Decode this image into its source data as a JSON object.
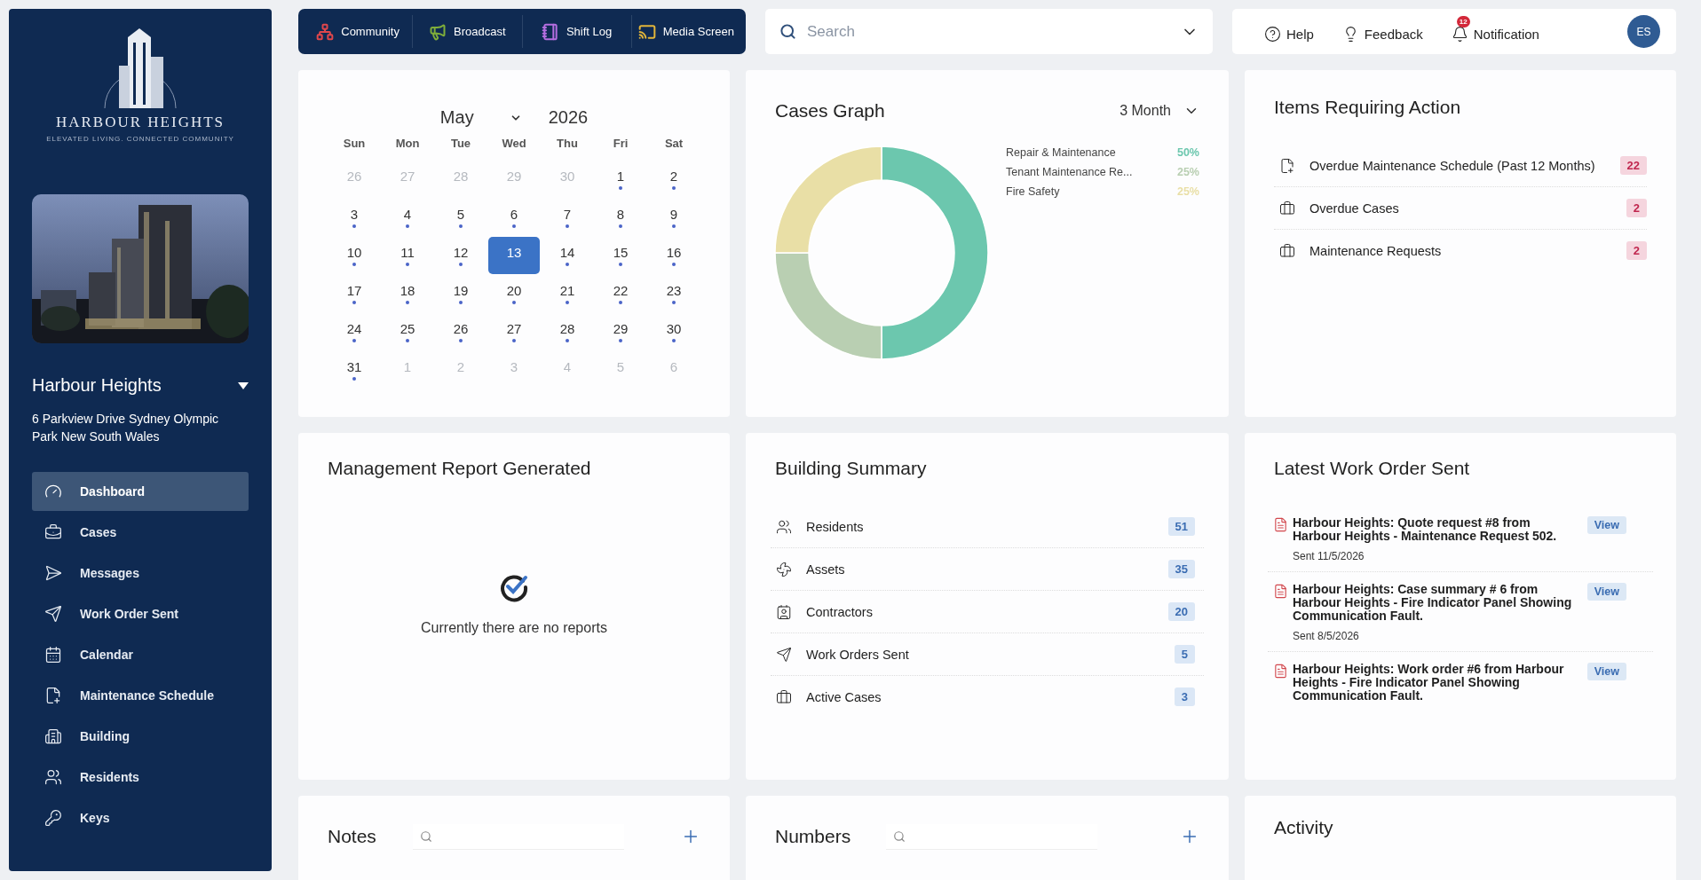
{
  "sidebar": {
    "logo": {
      "name": "HARBOUR HEIGHTS",
      "tagline": "ELEVATED LIVING. CONNECTED COMMUNITY"
    },
    "building": {
      "name": "Harbour Heights",
      "address": "6 Parkview Drive Sydney Olympic Park New South Wales"
    },
    "items": [
      {
        "label": "Dashboard",
        "selected": true
      },
      {
        "label": "Cases",
        "selected": false
      },
      {
        "label": "Messages",
        "selected": false
      },
      {
        "label": "Work Order Sent",
        "selected": false
      },
      {
        "label": "Calendar",
        "selected": false
      },
      {
        "label": "Maintenance Schedule",
        "selected": false
      },
      {
        "label": "Building",
        "selected": false
      },
      {
        "label": "Residents",
        "selected": false
      },
      {
        "label": "Keys",
        "selected": false
      }
    ]
  },
  "top_nav": [
    {
      "label": "Community",
      "color": "#e0474c"
    },
    {
      "label": "Broadcast",
      "color": "#7fae3a"
    },
    {
      "label": "Shift Log",
      "color": "#b56ee0"
    },
    {
      "label": "Media Screen",
      "color": "#e2b53a"
    }
  ],
  "search": {
    "placeholder": "Search"
  },
  "header_links": [
    {
      "label": "Help"
    },
    {
      "label": "Feedback"
    },
    {
      "label": "Notification",
      "badge": "12"
    }
  ],
  "avatar": "ES",
  "calendar": {
    "month": "May",
    "year": "2026",
    "weekdays": [
      "Sun",
      "Mon",
      "Tue",
      "Wed",
      "Thu",
      "Fri",
      "Sat"
    ],
    "days": [
      {
        "day": "26",
        "muted": true,
        "dot": false,
        "selected": false
      },
      {
        "day": "27",
        "muted": true,
        "dot": false,
        "selected": false
      },
      {
        "day": "28",
        "muted": true,
        "dot": false,
        "selected": false
      },
      {
        "day": "29",
        "muted": true,
        "dot": false,
        "selected": false
      },
      {
        "day": "30",
        "muted": true,
        "dot": false,
        "selected": false
      },
      {
        "day": "1",
        "muted": false,
        "dot": true,
        "selected": false
      },
      {
        "day": "2",
        "muted": false,
        "dot": true,
        "selected": false
      },
      {
        "day": "3",
        "muted": false,
        "dot": true,
        "selected": false
      },
      {
        "day": "4",
        "muted": false,
        "dot": true,
        "selected": false
      },
      {
        "day": "5",
        "muted": false,
        "dot": true,
        "selected": false
      },
      {
        "day": "6",
        "muted": false,
        "dot": true,
        "selected": false
      },
      {
        "day": "7",
        "muted": false,
        "dot": true,
        "selected": false
      },
      {
        "day": "8",
        "muted": false,
        "dot": true,
        "selected": false
      },
      {
        "day": "9",
        "muted": false,
        "dot": true,
        "selected": false
      },
      {
        "day": "10",
        "muted": false,
        "dot": true,
        "selected": false
      },
      {
        "day": "11",
        "muted": false,
        "dot": true,
        "selected": false
      },
      {
        "day": "12",
        "muted": false,
        "dot": true,
        "selected": false
      },
      {
        "day": "13",
        "muted": false,
        "dot": false,
        "selected": true
      },
      {
        "day": "14",
        "muted": false,
        "dot": true,
        "selected": false
      },
      {
        "day": "15",
        "muted": false,
        "dot": true,
        "selected": false
      },
      {
        "day": "16",
        "muted": false,
        "dot": true,
        "selected": false
      },
      {
        "day": "17",
        "muted": false,
        "dot": true,
        "selected": false
      },
      {
        "day": "18",
        "muted": false,
        "dot": true,
        "selected": false
      },
      {
        "day": "19",
        "muted": false,
        "dot": true,
        "selected": false
      },
      {
        "day": "20",
        "muted": false,
        "dot": true,
        "selected": false
      },
      {
        "day": "21",
        "muted": false,
        "dot": true,
        "selected": false
      },
      {
        "day": "22",
        "muted": false,
        "dot": true,
        "selected": false
      },
      {
        "day": "23",
        "muted": false,
        "dot": true,
        "selected": false
      },
      {
        "day": "24",
        "muted": false,
        "dot": true,
        "selected": false
      },
      {
        "day": "25",
        "muted": false,
        "dot": true,
        "selected": false
      },
      {
        "day": "26",
        "muted": false,
        "dot": true,
        "selected": false
      },
      {
        "day": "27",
        "muted": false,
        "dot": true,
        "selected": false
      },
      {
        "day": "28",
        "muted": false,
        "dot": true,
        "selected": false
      },
      {
        "day": "29",
        "muted": false,
        "dot": true,
        "selected": false
      },
      {
        "day": "30",
        "muted": false,
        "dot": true,
        "selected": false
      },
      {
        "day": "31",
        "muted": false,
        "dot": true,
        "selected": false
      },
      {
        "day": "1",
        "muted": true,
        "dot": false,
        "selected": false
      },
      {
        "day": "2",
        "muted": true,
        "dot": false,
        "selected": false
      },
      {
        "day": "3",
        "muted": true,
        "dot": false,
        "selected": false
      },
      {
        "day": "4",
        "muted": true,
        "dot": false,
        "selected": false
      },
      {
        "day": "5",
        "muted": true,
        "dot": false,
        "selected": false
      },
      {
        "day": "6",
        "muted": true,
        "dot": false,
        "selected": false
      }
    ]
  },
  "cases_graph": {
    "title": "Cases Graph",
    "range": "3 Month",
    "legend": [
      {
        "value": "50%",
        "color": "#6cc7ae"
      },
      {
        "value": "25%",
        "color": "#b9cfb2"
      },
      {
        "value": "25%",
        "color": "#e9dfa6"
      }
    ],
    "chart_data": {
      "type": "donut",
      "categories": [
        "Repair & Maintenance",
        "Tenant Maintenance Re...",
        "Fire Safety"
      ],
      "values": [
        50,
        25,
        25
      ]
    }
  },
  "items_requiring_action": {
    "title": "Items Requiring Action",
    "items": [
      {
        "label": "Overdue Maintenance Schedule (Past 12 Months)",
        "count": "22"
      },
      {
        "label": "Overdue Cases",
        "count": "2"
      },
      {
        "label": "Maintenance Requests",
        "count": "2"
      }
    ]
  },
  "management_report": {
    "title": "Management Report Generated",
    "empty_text": "Currently there are no reports"
  },
  "building_summary": {
    "title": "Building Summary",
    "items": [
      {
        "label": "Residents",
        "count": "51"
      },
      {
        "label": "Assets",
        "count": "35"
      },
      {
        "label": "Contractors",
        "count": "20"
      },
      {
        "label": "Work Orders Sent",
        "count": "5"
      },
      {
        "label": "Active Cases",
        "count": "3"
      }
    ]
  },
  "latest_work_order": {
    "title": "Latest Work Order Sent",
    "items": [
      {
        "title": "Harbour Heights: Quote request #8 from Harbour Heights - Maintenance Request 502.",
        "date": "Sent 11/5/2026",
        "action": "View"
      },
      {
        "title": "Harbour Heights: Case summary # 6 from Harbour Heights - Fire Indicator Panel Showing Communication Fault.",
        "date": "Sent 8/5/2026",
        "action": "View"
      },
      {
        "title": "Harbour Heights: Work order #6 from Harbour Heights - Fire Indicator Panel Showing Communication Fault.",
        "action": "View"
      }
    ]
  },
  "notes": {
    "title": "Notes"
  },
  "numbers": {
    "title": "Numbers"
  },
  "activity": {
    "title": "Activity"
  }
}
